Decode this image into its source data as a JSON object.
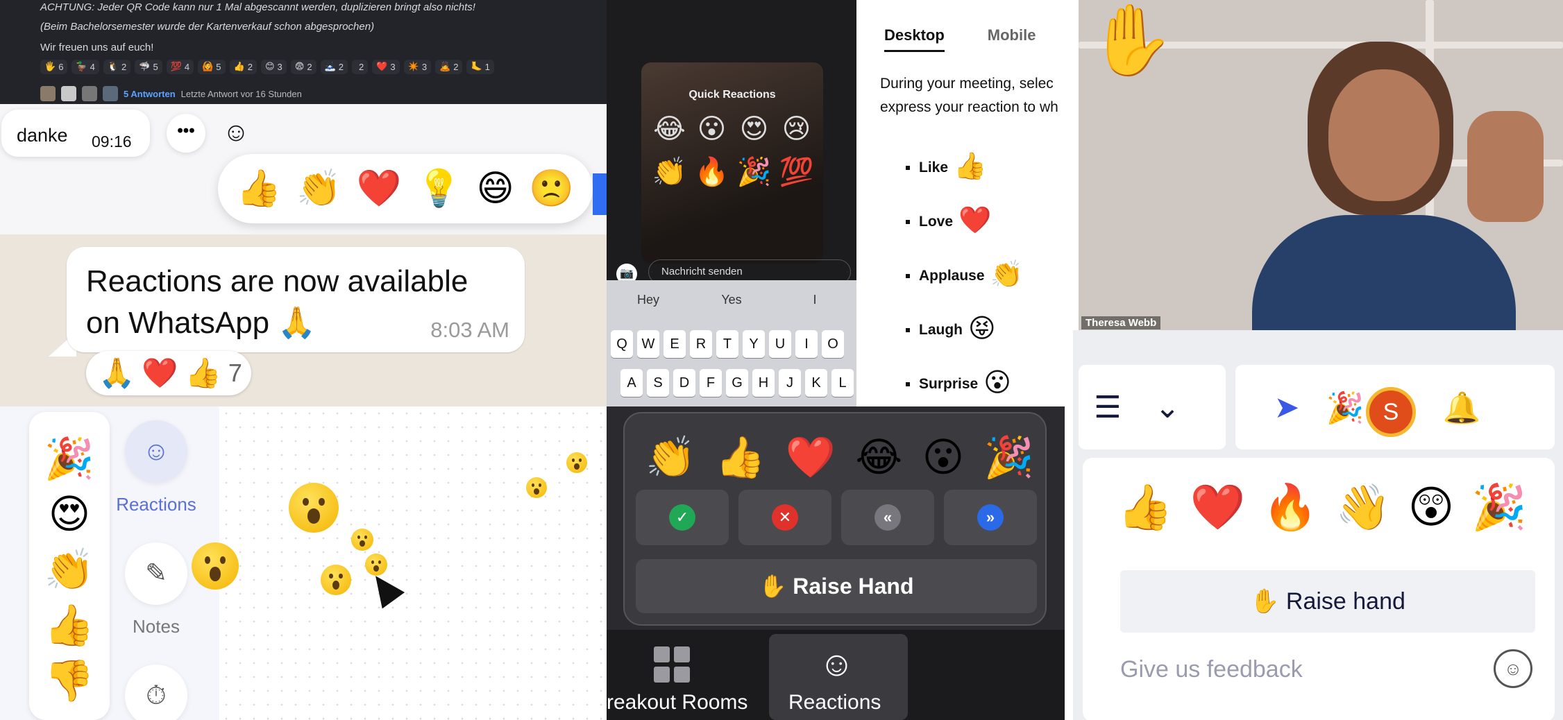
{
  "discord": {
    "line1": "ACHTUNG: Jeder QR Code kann nur 1 Mal abgescannt werden, duplizieren bringt also nichts!",
    "line2": "(Beim Bachelorsemester wurde der Kartenverkauf schon abgesprochen)",
    "line3": "Wir freuen uns auf euch!",
    "reactions": [
      {
        "emoji": "🖐",
        "count": "6"
      },
      {
        "emoji": "🦆",
        "count": "4"
      },
      {
        "emoji": "🐧",
        "count": "2"
      },
      {
        "emoji": "🦈",
        "count": "5"
      },
      {
        "emoji": "💯",
        "count": "4"
      },
      {
        "emoji": "🙆",
        "count": "5"
      },
      {
        "emoji": "👍",
        "count": "2"
      },
      {
        "emoji": "😊",
        "count": "3"
      },
      {
        "emoji": "😨",
        "count": "2"
      },
      {
        "emoji": "🗻",
        "count": "2"
      },
      {
        "emoji": "",
        "count": "2"
      },
      {
        "emoji": "❤️",
        "count": "3"
      },
      {
        "emoji": "✴️",
        "count": "3"
      },
      {
        "emoji": "🙇",
        "count": "2"
      },
      {
        "emoji": "🦶",
        "count": "1"
      }
    ],
    "replies": "5 Antworten",
    "last_reply": "Letzte Antwort vor 16 Stunden"
  },
  "chat": {
    "message": "danke",
    "time": "09:16",
    "more": "•••",
    "smile_icon": "☺",
    "bar": [
      "👍",
      "👏",
      "❤️",
      "💡",
      "😄",
      "🙁"
    ]
  },
  "whatsapp": {
    "message": "Reactions are now available on WhatsApp 🙏",
    "time": "8:03 AM",
    "reactions": [
      "🙏",
      "❤️",
      "👍"
    ],
    "count": "7"
  },
  "whiteboard": {
    "dock": [
      "🎉",
      "😍",
      "👏",
      "👍",
      "👎"
    ],
    "reactions_label": "Reactions",
    "notes_label": "Notes",
    "reactions_icon": "☺",
    "notes_icon": "✎",
    "timer_icon": "⏱"
  },
  "instagram": {
    "title": "Quick Reactions",
    "grid": [
      "😂",
      "😮",
      "😍",
      "😢",
      "👏",
      "🔥",
      "🎉",
      "💯"
    ],
    "send_placeholder": "Nachricht senden",
    "camera_icon": "📷",
    "suggestions": [
      "Hey",
      "Yes",
      "I"
    ],
    "row1": [
      "Q",
      "W",
      "E",
      "R",
      "T",
      "Y",
      "U",
      "I",
      "O"
    ],
    "row2": [
      "A",
      "S",
      "D",
      "F",
      "G",
      "H",
      "J",
      "K",
      "L"
    ]
  },
  "zoom": {
    "emojis": [
      "👏",
      "👍",
      "❤️",
      "😂",
      "😮",
      "🎉"
    ],
    "status_buttons": [
      {
        "icon": "✓",
        "color": "#21a857"
      },
      {
        "icon": "✕",
        "color": "#e0322b"
      },
      {
        "icon": "«",
        "color": "#77777d"
      },
      {
        "icon": "»",
        "color": "#2a6ae8"
      }
    ],
    "raise_hand": "✋ Raise Hand",
    "breakout": "reakout Rooms",
    "reactions_tab": "Reactions",
    "reactions_tab_icon": "☺"
  },
  "doc": {
    "tab_desktop": "Desktop",
    "tab_mobile": "Mobile",
    "para1": "During your meeting, selec",
    "para2": "express your reaction to wh",
    "items": [
      {
        "label": "Like",
        "emoji": "👍"
      },
      {
        "label": "Love",
        "emoji": "❤️"
      },
      {
        "label": "Applause",
        "emoji": "👏"
      },
      {
        "label": "Laugh",
        "emoji": "😝"
      },
      {
        "label": "Surprise",
        "emoji": "😮"
      }
    ]
  },
  "video": {
    "wave_emoji": "✋",
    "name": "Theresa Webb"
  },
  "picker": {
    "doc_icon": "☰",
    "collapse_icon": "⌄",
    "pointer_icon": "➤",
    "party_icon": "🎉",
    "avatar_letter": "S",
    "bell_icon": "🔔",
    "emojis": [
      "👍",
      "❤️",
      "🔥",
      "👋",
      "😲",
      "🎉"
    ],
    "raise_hand": "Raise hand",
    "raise_icon": "✋",
    "feedback": "Give us feedback",
    "feedback_icon": "☺"
  }
}
